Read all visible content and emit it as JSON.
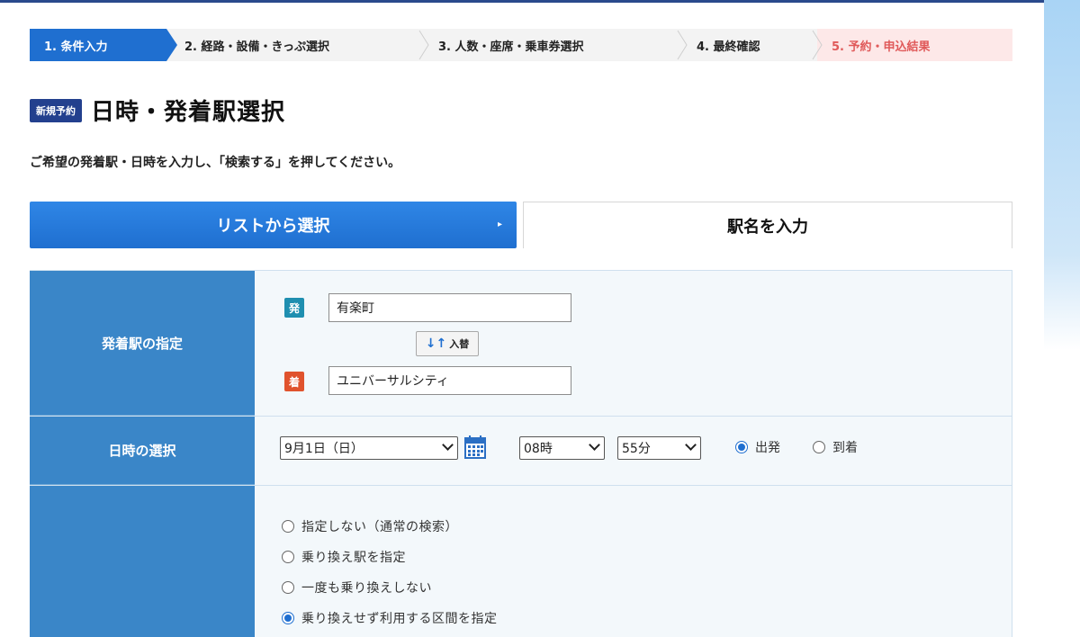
{
  "steps": [
    {
      "label": "1. 条件入力"
    },
    {
      "label": "2. 経路・設備・きっぷ選択"
    },
    {
      "label": "3. 人数・座席・乗車券選択"
    },
    {
      "label": "4. 最終確認"
    },
    {
      "label": "5. 予約・申込結果"
    }
  ],
  "header": {
    "badge": "新規予約",
    "title": "日時・発着駅選択"
  },
  "instruction": "ご希望の発着駅・日時を入力し、「検索する」を押してください。",
  "tabs": {
    "list": "リストから選択",
    "list_arrow": "▸",
    "name": "駅名を入力"
  },
  "station": {
    "label": "発着駅の指定",
    "dep_tag": "発",
    "dep_value": "有楽町",
    "swap_arrows": "↓↑",
    "swap_label": "入替",
    "arr_tag": "着",
    "arr_value": "ユニバーサルシティ"
  },
  "datetime": {
    "label": "日時の選択",
    "date": "9月1日（日）",
    "hour": "08時",
    "minute": "55分",
    "dep_radio": "出発",
    "arr_radio": "到着",
    "selected": "dep"
  },
  "transfer": {
    "options": [
      {
        "label": "指定しない（通常の検索）",
        "selected": false
      },
      {
        "label": "乗り換え駅を指定",
        "selected": false
      },
      {
        "label": "一度も乗り換えしない",
        "selected": false
      },
      {
        "label": "乗り換えせず利用する区間を指定",
        "selected": true
      }
    ]
  },
  "colors": {
    "accent": "#1f6fd0",
    "label_bg": "#3a86c8",
    "dep_tag": "#1f8fb0",
    "arr_tag": "#e0532d",
    "badge": "#23408e"
  }
}
